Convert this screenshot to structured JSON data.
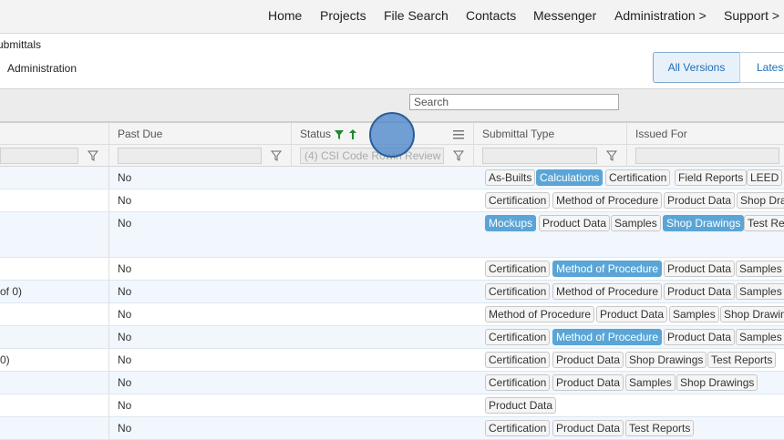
{
  "nav": [
    "Home",
    "Projects",
    "File Search",
    "Contacts",
    "Messenger",
    "Administration >",
    "Support >"
  ],
  "breadcrumb": "ubmittals",
  "page_subtitle": "Administration",
  "version_buttons": {
    "all": "All Versions",
    "latest": "Latest"
  },
  "search": {
    "placeholder": "Search"
  },
  "columns": {
    "past_due": "Past Due",
    "status": "Status",
    "submittal_type": "Submittal Type",
    "issued_for": "Issued For"
  },
  "status_filter_value": "(4) CSI Code Rowin Review",
  "rows": [
    {
      "left": "",
      "past_due": "No",
      "tags": [
        "As-Builts",
        "Calculations",
        "Certification",
        "Field Reports",
        "LEED"
      ]
    },
    {
      "left": "",
      "past_due": "No",
      "tags": [
        "Certification",
        "Method of Procedure",
        "Product Data",
        "Shop Dra"
      ]
    },
    {
      "left": "",
      "past_due": "No",
      "tags": [
        "Mockups",
        "Product Data",
        "Samples",
        "Shop Drawings",
        "Test Re"
      ]
    },
    {
      "left": "",
      "past_due": "No",
      "tags": [
        "Certification",
        "Method of Procedure",
        "Product Data",
        "Samples"
      ]
    },
    {
      "left": "of 0)",
      "past_due": "No",
      "tags": [
        "Certification",
        "Method of Procedure",
        "Product Data",
        "Samples"
      ]
    },
    {
      "left": "",
      "past_due": "No",
      "tags": [
        "Method of Procedure",
        "Product Data",
        "Samples",
        "Shop Drawin"
      ]
    },
    {
      "left": "",
      "past_due": "No",
      "tags": [
        "Certification",
        "Method of Procedure",
        "Product Data",
        "Samples"
      ]
    },
    {
      "left": "0)",
      "past_due": "No",
      "tags": [
        "Certification",
        "Product Data",
        "Shop Drawings",
        "Test Reports"
      ]
    },
    {
      "left": "",
      "past_due": "No",
      "tags": [
        "Certification",
        "Product Data",
        "Samples",
        "Shop Drawings"
      ]
    },
    {
      "left": "",
      "past_due": "No",
      "tags": [
        "Product Data"
      ]
    },
    {
      "left": "",
      "past_due": "No",
      "tags": [
        "Certification",
        "Product Data",
        "Test Reports"
      ]
    }
  ],
  "colors": {
    "tag_highlight": "#5aa5d6",
    "status_filter_icon": "#1e8a2e",
    "link": "#1f6fb8"
  }
}
